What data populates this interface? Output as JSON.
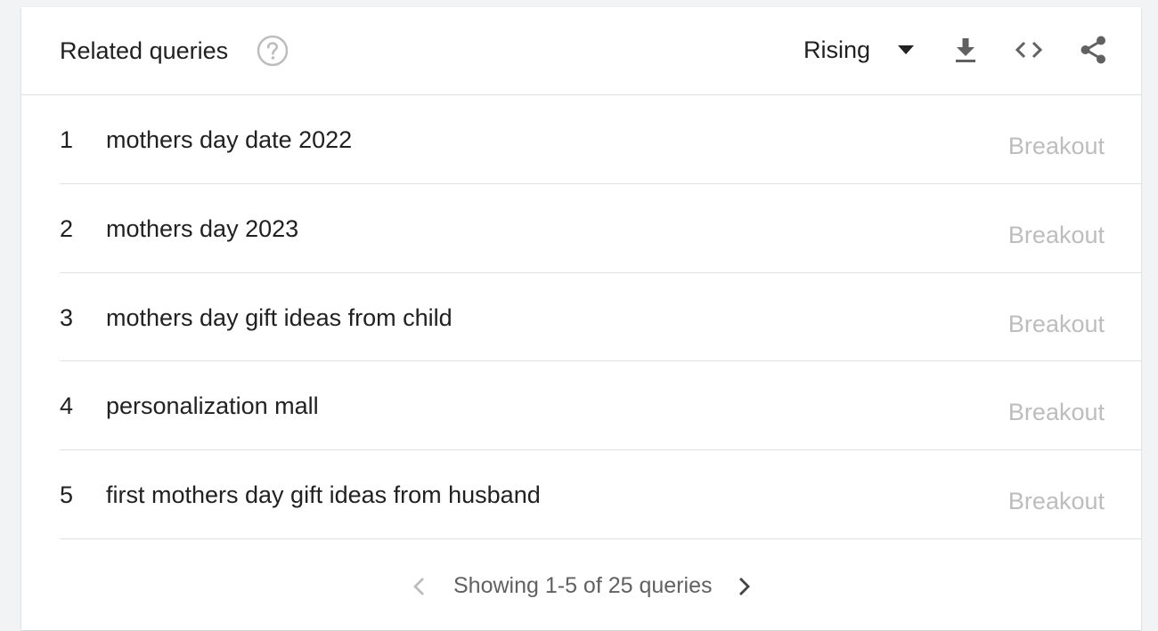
{
  "header": {
    "title": "Related queries",
    "dropdown_label": "Rising"
  },
  "rows": [
    {
      "index": "1",
      "query": "mothers day date 2022",
      "value": "Breakout"
    },
    {
      "index": "2",
      "query": "mothers day 2023",
      "value": "Breakout"
    },
    {
      "index": "3",
      "query": "mothers day gift ideas from child",
      "value": "Breakout"
    },
    {
      "index": "4",
      "query": "personalization mall",
      "value": "Breakout"
    },
    {
      "index": "5",
      "query": "first mothers day gift ideas from husband",
      "value": "Breakout"
    }
  ],
  "pager": {
    "text": "Showing 1-5 of 25 queries"
  },
  "icons": {
    "help": "help-circle-icon",
    "dropdown": "caret-down-icon",
    "download": "download-icon",
    "embed": "embed-code-icon",
    "share": "share-icon",
    "prev": "chevron-left-icon",
    "next": "chevron-right-icon"
  },
  "colors": {
    "text": "#212121",
    "muted": "#bdbdbd",
    "icon": "#616161",
    "disabled_icon": "#bdbdbd",
    "divider": "#e0e0e0"
  }
}
